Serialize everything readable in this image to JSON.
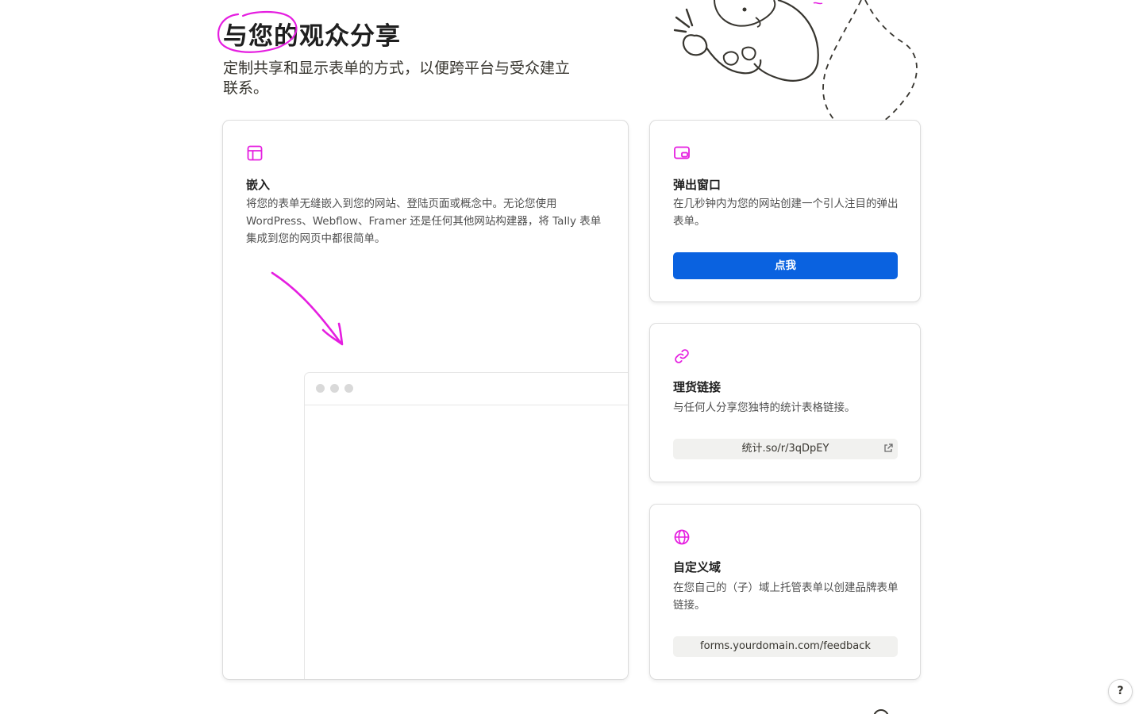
{
  "header": {
    "title": "与您的观众分享",
    "subtitle": "定制共享和显示表单的方式，以便跨平台与受众建立联系。"
  },
  "cards": {
    "embed": {
      "icon": "layout-icon",
      "title": "嵌入",
      "description": "将您的表单无缝嵌入到您的网站、登陆页面或概念中。无论您使用 WordPress、Webflow、Framer 还是任何其他网站构建器，将 Tally 表单集成到您的网页中都很简单。"
    },
    "popup": {
      "icon": "popup-window-icon",
      "title": "弹出窗口",
      "description": "在几秒钟内为您的网站创建一个引人注目的弹出表单。",
      "button_label": "点我"
    },
    "share_link": {
      "icon": "link-icon",
      "title": "理货链接",
      "description": "与任何人分享您独特的统计表格链接。",
      "url": "统计.so/r/3qDpEY"
    },
    "custom_domain": {
      "icon": "globe-icon",
      "title": "自定义域",
      "description": "在您自己的（子）域上托管表单以创建品牌表单链接。",
      "url": "forms.yourdomain.com/feedback"
    }
  },
  "help": {
    "label": "?"
  },
  "colors": {
    "accent_magenta": "#e51ee0",
    "primary_blue": "#0a62e0",
    "chip_bg": "#f1f1ef"
  }
}
